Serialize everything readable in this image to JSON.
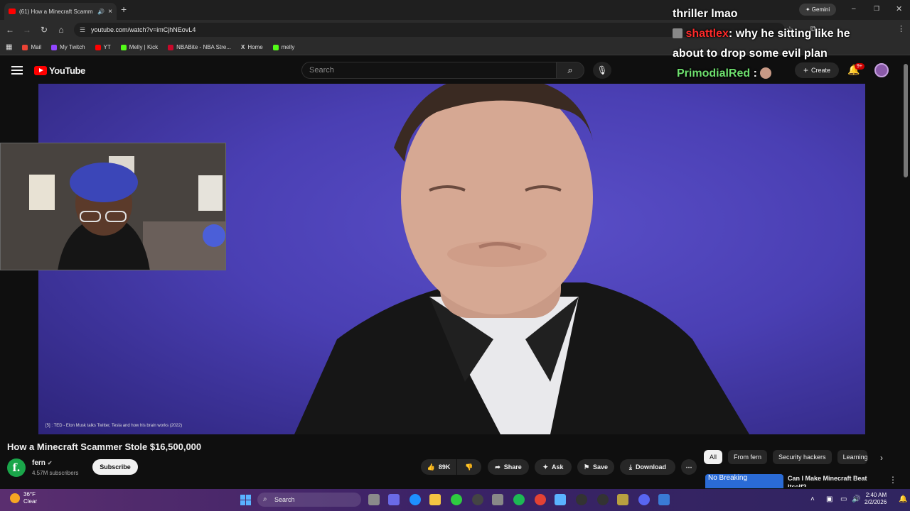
{
  "browser": {
    "tab_title": "(61) How a Minecraft Scamm",
    "url": "youtube.com/watch?v=imCjhNEovL4",
    "gemini_label": "Gemini",
    "bookmarks": [
      "Mail",
      "My Twitch",
      "YT",
      "Melly | Kick",
      "NBABite - NBA Stre...",
      "Home",
      "melly"
    ]
  },
  "youtube": {
    "logo_text": "YouTube",
    "search_placeholder": "Search",
    "create_label": "Create",
    "notifications_badge": "9+"
  },
  "video": {
    "credit": "[5] : TED - Elon Musk talks Twitter, Tesla and how his brain works (2022)",
    "title": "How a Minecraft Scammer Stole $16,500,000",
    "channel_name": "fern",
    "channel_initial": "f.",
    "subscribers": "4.57M subscribers",
    "subscribe_label": "Subscribe",
    "likes": "89K",
    "share_label": "Share",
    "ask_label": "Ask",
    "save_label": "Save",
    "download_label": "Download"
  },
  "overlay_chat": {
    "line1": "thriller lmao",
    "user2": "shattlex",
    "msg2a": ": why he sitting like he",
    "msg2b": "about to drop some evil plan",
    "user3": "PrimodialRed",
    "msg3": ":"
  },
  "sidebar": {
    "chips": [
      "All",
      "From fern",
      "Security hackers",
      "Learning"
    ],
    "rec_title": "Can I Make Minecraft Beat Itself?",
    "rec_thumb_text": "No Breaking"
  },
  "taskbar": {
    "temperature": "36°F",
    "weather": "Clear",
    "search_label": "Search",
    "time": "2:40 AM",
    "date": "2/2/2026"
  },
  "colors": {
    "accent": "#ff0000",
    "chat_user2": "#ff2a2a",
    "chat_user3": "#6ee06e"
  }
}
